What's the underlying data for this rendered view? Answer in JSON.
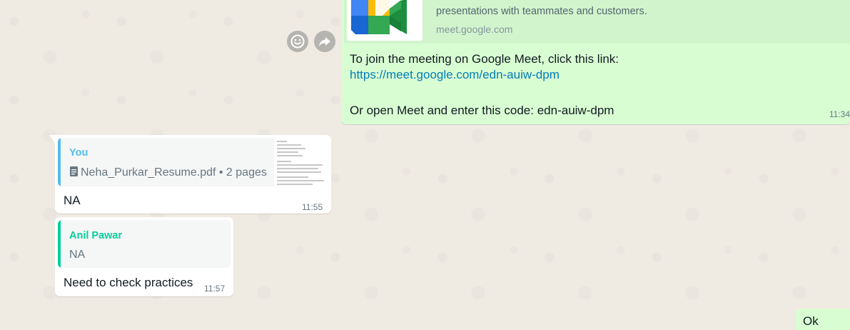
{
  "outgoing_link_message": {
    "preview_description": "presentations with teammates and customers.",
    "preview_domain": "meet.google.com",
    "line1": "To join the meeting on Google Meet, click this link:",
    "link": "https://meet.google.com/edn-auiw-dpm",
    "line3": "Or open Meet and enter this code: edn-auiw-dpm",
    "time": "11:34",
    "colors": {
      "bubble": "#d9fdd3",
      "link": "#027eb5"
    }
  },
  "actions": {
    "emoji_icon": "emoji-icon",
    "forward_icon": "forward-icon"
  },
  "document_reply_message": {
    "quote_sender": "You",
    "quote_icon": "document-icon",
    "quote_filename": "Neha_Purkar_Resume.pdf",
    "quote_meta": " • 2 pages",
    "text": "NA",
    "time": "11:55",
    "quote_color": "#53bdeb"
  },
  "text_reply_message": {
    "quote_sender": "Anil Pawar",
    "quote_text": "NA",
    "text": "Need to check practices",
    "time": "11:57",
    "quote_color": "#06cf9c"
  },
  "partial_outgoing_message": {
    "text": "Ok"
  }
}
